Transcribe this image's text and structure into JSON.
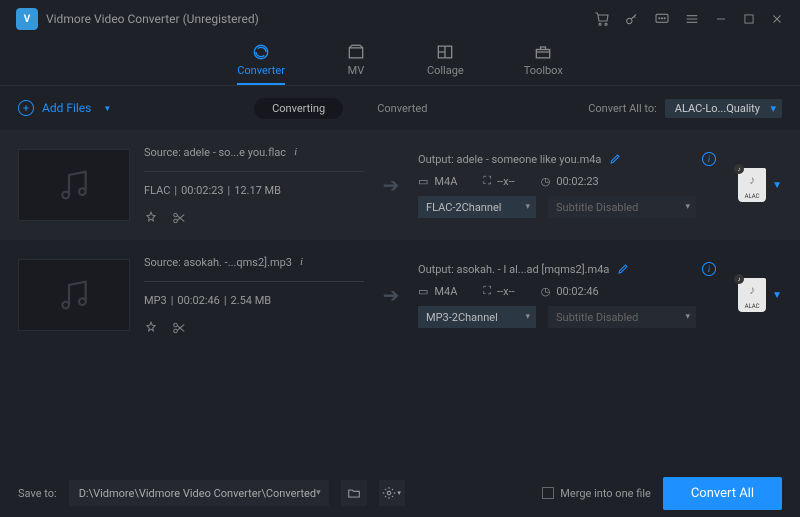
{
  "app": {
    "title": "Vidmore Video Converter (Unregistered)"
  },
  "nav": {
    "items": [
      {
        "label": "Converter"
      },
      {
        "label": "MV"
      },
      {
        "label": "Collage"
      },
      {
        "label": "Toolbox"
      }
    ]
  },
  "toolbar": {
    "add_files": "Add Files",
    "tab_converting": "Converting",
    "tab_converted": "Converted",
    "convert_all_to": "Convert All to:",
    "format": "ALAC-Lo...Quality"
  },
  "rows": [
    {
      "source_label": "Source: adele - so...e you.flac",
      "codec": "FLAC",
      "duration": "00:02:23",
      "size": "12.17 MB",
      "output_label": "Output: adele - someone like you.m4a",
      "out_container": "M4A",
      "out_res": "--x--",
      "out_duration": "00:02:23",
      "audio_channel": "FLAC-2Channel",
      "subtitle": "Subtitle Disabled",
      "target": "ALAC"
    },
    {
      "source_label": "Source: asokah. -...qms2].mp3",
      "codec": "MP3",
      "duration": "00:02:46",
      "size": "2.54 MB",
      "output_label": "Output: asokah. - I al...ad [mqms2].m4a",
      "out_container": "M4A",
      "out_res": "--x--",
      "out_duration": "00:02:46",
      "audio_channel": "MP3-2Channel",
      "subtitle": "Subtitle Disabled",
      "target": "ALAC"
    }
  ],
  "footer": {
    "save_to_label": "Save to:",
    "save_path": "D:\\Vidmore\\Vidmore Video Converter\\Converted",
    "merge_label": "Merge into one file",
    "convert_btn": "Convert All"
  }
}
